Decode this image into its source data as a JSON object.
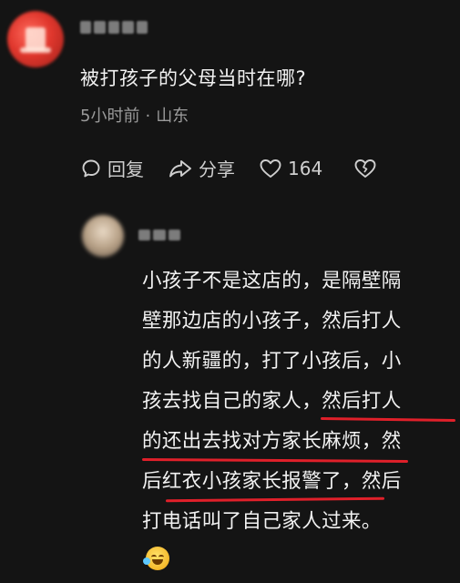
{
  "comment": {
    "text": "被打孩子的父母当时在哪?",
    "time": "5小时前",
    "separator": "·",
    "location": "山东",
    "actions": {
      "reply_label": "回复",
      "share_label": "分享",
      "like_count": "164"
    }
  },
  "reply": {
    "lines": [
      "小孩子不是这店的，是隔壁隔",
      "壁那边店的小孩子，然后打人",
      "的人新疆的，打了小孩后，小",
      "孩去找自己的家人，然后打人",
      "的还出去找对方家长麻烦，然",
      "后红衣小孩家长报警了，然后",
      "打电话叫了自己家人过来。"
    ]
  },
  "colors": {
    "background": "#141414",
    "underline": "#e0202a",
    "muted_text": "#9a9a9a"
  },
  "icons": [
    "comment-bubble-icon",
    "share-arrow-icon",
    "heart-icon",
    "broken-heart-icon",
    "laughing-tears-emoji"
  ]
}
